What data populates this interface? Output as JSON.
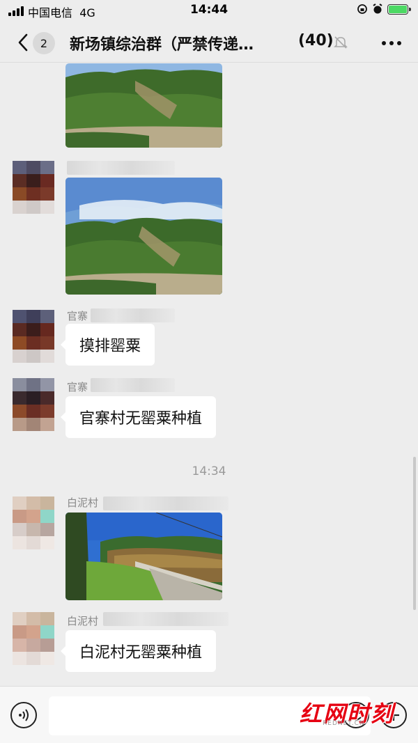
{
  "status_bar": {
    "carrier": "中国电信",
    "network": "4G",
    "time": "14:44"
  },
  "header": {
    "unread": "2",
    "title": "新场镇综治群（严禁传递…",
    "member_count": "(40)"
  },
  "messages": {
    "sender_3": "官寨",
    "text_3": "摸排罂粟",
    "sender_4": "官寨",
    "text_4": "官寨村无罂粟种植",
    "timestamp": "14:34",
    "sender_5": "白泥村",
    "sender_6": "白泥村",
    "text_6": "白泥村无罂粟种植"
  },
  "watermark": {
    "main": "红网时刻",
    "sub": "REDNET.CN"
  },
  "icons": [
    "signal-icon",
    "lock-rotation-icon",
    "alarm-icon",
    "battery-icon",
    "back-arrow-icon",
    "mute-bell-icon",
    "more-icon",
    "voice-icon",
    "emoji-icon",
    "plus-icon"
  ]
}
